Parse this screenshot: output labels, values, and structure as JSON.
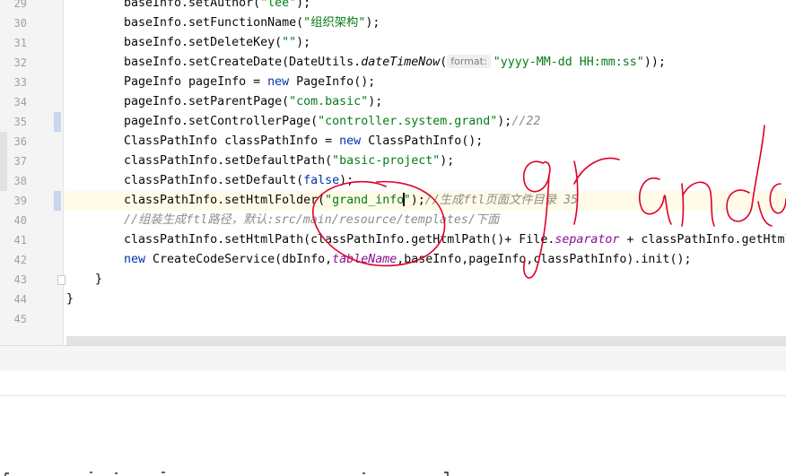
{
  "editor": {
    "line_numbers": [
      "29",
      "30",
      "31",
      "32",
      "33",
      "34",
      "35",
      "36",
      "37",
      "38",
      "39",
      "40",
      "41",
      "42",
      "43",
      "44",
      "45"
    ],
    "lines": [
      {
        "parts": [
          {
            "t": "baseInfo.setAuthor("
          },
          {
            "t": "\"lee\"",
            "c": "s"
          },
          {
            "t": ");"
          }
        ]
      },
      {
        "parts": [
          {
            "t": "baseInfo.setFunctionName("
          },
          {
            "t": "\"组织架构\"",
            "c": "s"
          },
          {
            "t": ");"
          }
        ]
      },
      {
        "parts": [
          {
            "t": "baseInfo.setDeleteKey("
          },
          {
            "t": "\"\"",
            "c": "s"
          },
          {
            "t": ");"
          }
        ]
      },
      {
        "parts": [
          {
            "t": "baseInfo.setCreateDate(DateUtils."
          },
          {
            "t": "dateTimeNow",
            "c": "m"
          },
          {
            "t": "("
          },
          {
            "t": "format:",
            "c": "hint"
          },
          {
            "t": "\"yyyy-MM-dd HH:mm:ss\"",
            "c": "s"
          },
          {
            "t": "));"
          }
        ]
      },
      {
        "parts": [
          {
            "t": "PageInfo pageInfo = "
          },
          {
            "t": "new",
            "c": "k"
          },
          {
            "t": " PageInfo();"
          }
        ]
      },
      {
        "parts": [
          {
            "t": "pageInfo.setParentPage("
          },
          {
            "t": "\"com.basic\"",
            "c": "s"
          },
          {
            "t": ");"
          }
        ]
      },
      {
        "parts": [
          {
            "t": "pageInfo.setControllerPage("
          },
          {
            "t": "\"controller.system.grand\"",
            "c": "s"
          },
          {
            "t": ");"
          },
          {
            "t": "//22",
            "c": "c"
          }
        ]
      },
      {
        "parts": [
          {
            "t": "ClassPathInfo classPathInfo = "
          },
          {
            "t": "new",
            "c": "k"
          },
          {
            "t": " ClassPathInfo();"
          }
        ]
      },
      {
        "parts": [
          {
            "t": "classPathInfo.setDefaultPath("
          },
          {
            "t": "\"basic-project\"",
            "c": "s"
          },
          {
            "t": ");"
          }
        ]
      },
      {
        "parts": [
          {
            "t": "classPathInfo.setDefault("
          },
          {
            "t": "false",
            "c": "k"
          },
          {
            "t": ");"
          }
        ]
      },
      {
        "parts": [
          {
            "t": "classPathInfo.setHtmlFolder("
          },
          {
            "t": "\"grand_info",
            "c": "s"
          },
          {
            "t": "",
            "c": "caret"
          },
          {
            "t": "\"",
            "c": "s"
          },
          {
            "t": ");"
          },
          {
            "t": "//生成ftl页面文件目录 35",
            "c": "c"
          }
        ]
      },
      {
        "parts": [
          {
            "t": "//组装生成ftl路径，默认:src/main/resource/templates/下面",
            "c": "c"
          }
        ]
      },
      {
        "parts": [
          {
            "t": "classPathInfo.setHtmlPath(classPathInfo.getHtmlPath()+ File."
          },
          {
            "t": "separator",
            "c": "f"
          },
          {
            "t": " + classPathInfo.getHtmlFolder()"
          }
        ]
      },
      {
        "parts": [
          {
            "t": "new",
            "c": "k"
          },
          {
            "t": " CreateCodeService(dbInfo,"
          },
          {
            "t": "tableName",
            "c": "f"
          },
          {
            "t": ",baseInfo,pageInfo,classPathInfo).init();"
          }
        ]
      },
      {
        "parts": [
          {
            "t": "}"
          }
        ]
      },
      {
        "parts": [
          {
            "t": "}"
          }
        ]
      },
      {
        "parts": []
      }
    ]
  },
  "colors": {
    "keyword": "#0033b3",
    "string": "#067d17",
    "comment": "#8c8c8c",
    "field": "#871094",
    "annotation_ink": "#e0002a"
  },
  "overlay": {
    "icon": "handwritten-red-scribble"
  }
}
